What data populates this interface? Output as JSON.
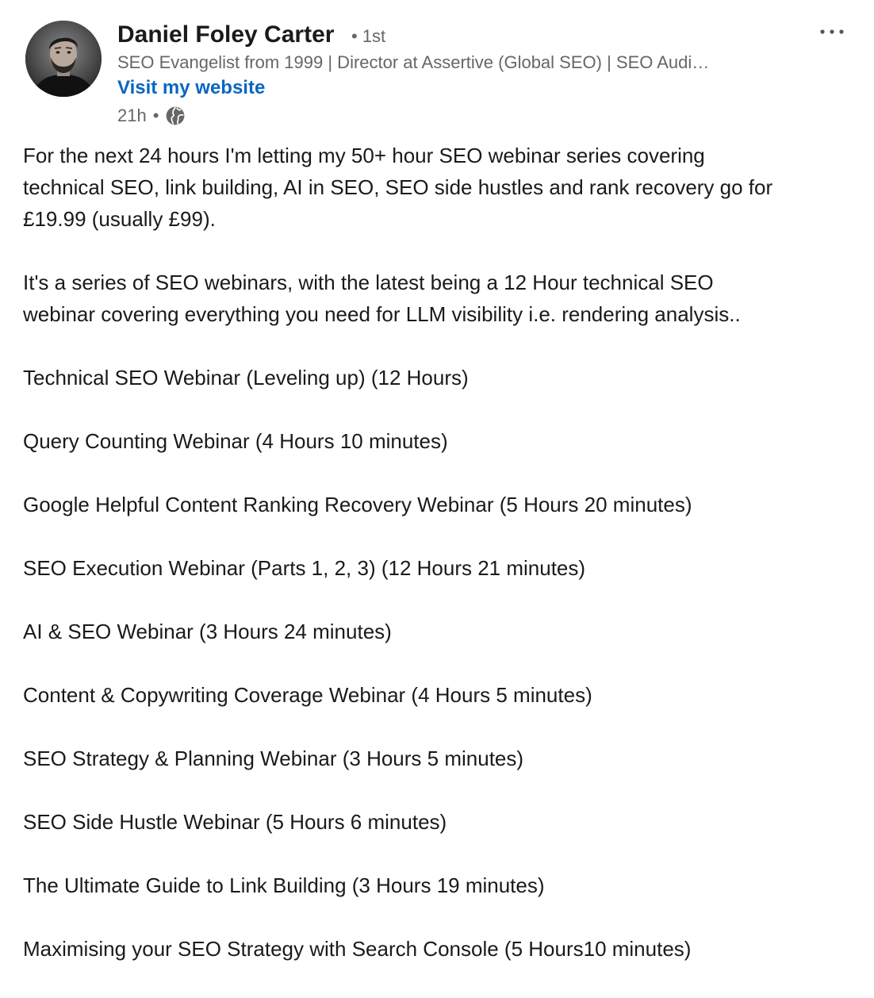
{
  "author": {
    "name": "Daniel Foley Carter",
    "degree": "• 1st",
    "headline": "SEO Evangelist from 1999 | Director at Assertive (Global SEO) | SEO Audi…",
    "link_label": "Visit my website",
    "time": "21h",
    "separator": "•",
    "visibility_icon": "globe-icon",
    "avatar_icon": "avatar-photo"
  },
  "menu": {
    "more_icon": "more-options-icon"
  },
  "post": {
    "intro_line1": "For the next 24 hours I'm letting my 50+ hour SEO webinar series covering",
    "intro_line2": "technical SEO, link building, AI in SEO, SEO side hustles and rank recovery go for",
    "intro_line3": "£19.99 (usually £99).",
    "para2_line1": "It's a series of SEO webinars, with the latest being a 12 Hour technical SEO",
    "para2_line2": "webinar covering everything you need for LLM visibility i.e. rendering analysis..",
    "webinars": [
      "Technical SEO Webinar (Leveling up) (12 Hours)",
      "Query Counting Webinar (4 Hours 10 minutes)",
      "Google Helpful Content Ranking Recovery Webinar (5 Hours 20 minutes)",
      "SEO Execution Webinar (Parts 1, 2, 3) (12 Hours 21 minutes)",
      "AI & SEO Webinar (3 Hours 24 minutes)",
      "Content & Copywriting Coverage Webinar (4 Hours 5 minutes)",
      "SEO Strategy & Planning Webinar (3 Hours 5 minutes)",
      "SEO Side Hustle Webinar (5 Hours 6 minutes)",
      "The Ultimate Guide to Link Building (3 Hours 19 minutes)",
      "Maximising your SEO Strategy with Search Console (5 Hours10 minutes)"
    ]
  },
  "colors": {
    "link": "#0a66c2",
    "muted": "#666666",
    "text": "#1a1a1a"
  }
}
